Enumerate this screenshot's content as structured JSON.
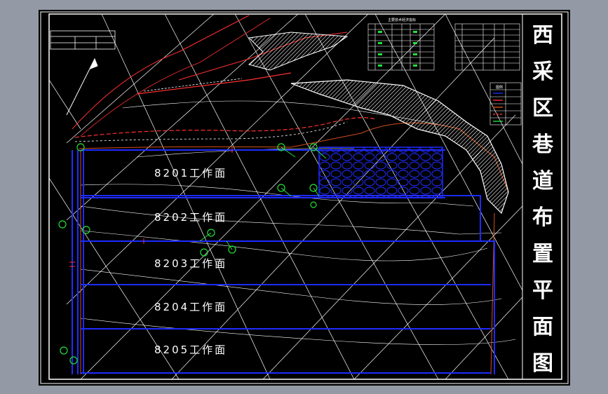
{
  "drawing": {
    "title_chars": [
      "西",
      "采",
      "区",
      "巷",
      "道",
      "布",
      "置",
      "平",
      "面",
      "图"
    ],
    "faces": [
      {
        "label": "8201工作面"
      },
      {
        "label": "8202工作面"
      },
      {
        "label": "8203工作面"
      },
      {
        "label": "8204工作面"
      },
      {
        "label": "8205工作面"
      }
    ],
    "legend_table_title": "主要技术经济指标",
    "legend_small_title": "图例"
  },
  "colors": {
    "background": "#000000",
    "frame": "#ffffff",
    "roadway": "#1f2bff",
    "contour": "#ffffff",
    "boundary_red": "#ff3030",
    "fault_orange": "#d4501a",
    "symbol_green": "#22e03a"
  }
}
